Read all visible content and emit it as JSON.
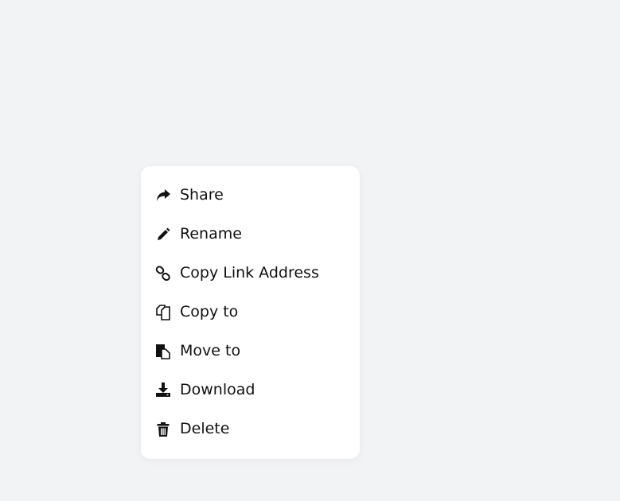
{
  "menu": {
    "items": [
      {
        "label": "Share",
        "icon": "share-icon"
      },
      {
        "label": "Rename",
        "icon": "pencil-icon"
      },
      {
        "label": "Copy Link Address",
        "icon": "link-icon"
      },
      {
        "label": "Copy to",
        "icon": "copy-icon"
      },
      {
        "label": "Move to",
        "icon": "move-icon"
      },
      {
        "label": "Download",
        "icon": "download-icon"
      },
      {
        "label": "Delete",
        "icon": "trash-icon"
      }
    ]
  },
  "colors": {
    "background": "#f2f3f5",
    "menu_background": "#ffffff",
    "text": "#111111"
  }
}
